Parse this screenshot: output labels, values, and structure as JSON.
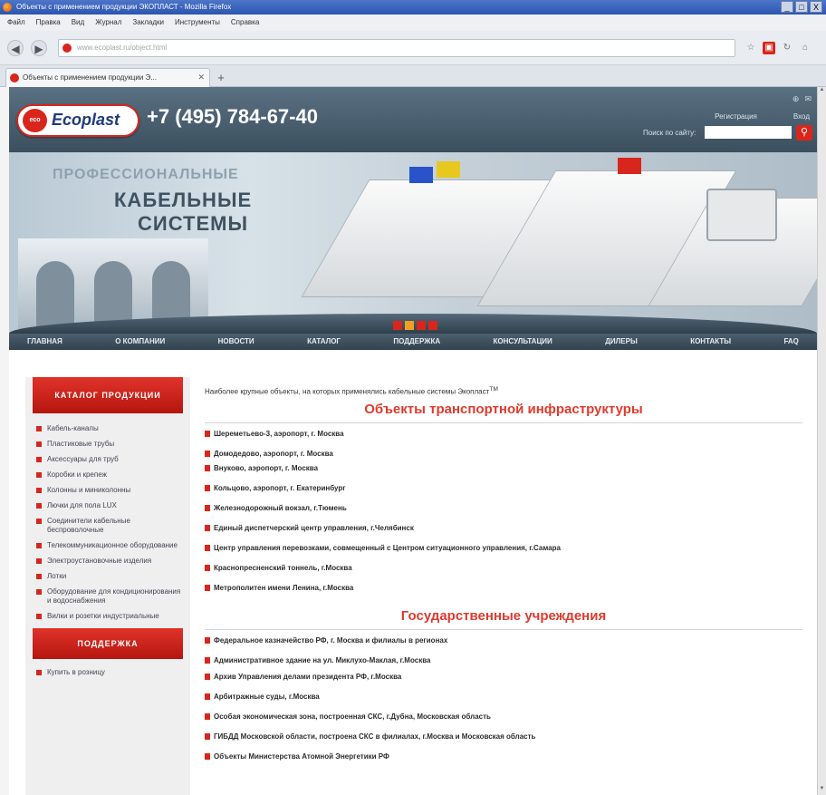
{
  "browser": {
    "window_title": "Объекты с применением продукции ЭКОПЛАСТ - Mozilla Firefox",
    "menu": [
      "Файл",
      "Правка",
      "Вид",
      "Журнал",
      "Закладки",
      "Инструменты",
      "Справка"
    ],
    "url": "www.ecoplast.ru/object.html",
    "tab_title": "Объекты с применением продукции Э...",
    "window_buttons": [
      "_",
      "□",
      "X"
    ]
  },
  "header": {
    "logo_badge": "eco",
    "logo_name": "Ecoplast",
    "phone": "+7 (495) 784-67-40",
    "links": [
      "Регистрация",
      "Вход"
    ],
    "search_label": "Поиск по сайту:"
  },
  "banner": {
    "line1": "ПРОФЕССИОНАЛЬНЫЕ",
    "line2": "КАБЕЛЬНЫЕ",
    "line3": "СИСТЕМЫ",
    "slide_count": 4,
    "active_slide": 2
  },
  "nav": [
    "ГЛАВНАЯ",
    "О КОМПАНИИ",
    "НОВОСТИ",
    "КАТАЛОГ",
    "ПОДДЕРЖКА",
    "КОНСУЛЬТАЦИИ",
    "ДИЛЕРЫ",
    "КОНТАКТЫ",
    "FAQ"
  ],
  "sidebar": {
    "catalog_title": "КАТАЛОГ ПРОДУКЦИИ",
    "catalog_items": [
      "Кабель-каналы",
      "Пластиковые трубы",
      "Аксессуары для труб",
      "Коробки и крепеж",
      "Колонны и миниколонны",
      "Лючки для пола LUX",
      "Соединители кабельные беспроволочные",
      "Телекоммуникационное оборудование",
      "Электроустановочные изделия",
      "Лотки",
      "Оборудование для кондиционирования и водоснабжения",
      "Вилки и розетки индустриальные"
    ],
    "support_title": "ПОДДЕРЖКА",
    "support_items": [
      "Купить в розницу"
    ]
  },
  "content": {
    "intro": "Наиболее крупные объекты, на которых применялись кабельные системы Экопласт",
    "intro_tm": "TM",
    "section1_title": "Объекты транспортной инфраструктуры",
    "section1_items": [
      "Шереметьево-3, аэропорт, г. Москва",
      "Домодедово, аэропорт, г. Москва",
      "Внуково, аэропорт, г. Москва",
      "Кольцово, аэропорт, г. Екатеринбург",
      "Железнодорожный вокзал, г.Тюмень",
      "Единый диспетчерский центр управления, г.Челябинск",
      "Центр управления перевозками, совмещенный с Центром ситуационного управления, г.Самара",
      "Краснопресненский тоннель, г.Москва",
      "Метрополитен имени Ленина, г.Москва"
    ],
    "section2_title": "Государственные учреждения",
    "section2_items": [
      "Федеральное казначейство РФ, г. Москва и филиалы в регионах",
      "Административное здание на ул. Миклухо-Маклая, г.Москва",
      "Архив Управления делами президента РФ, г.Москва",
      "Арбитражные суды, г.Москва",
      "Особая экономическая зона, построенная СКС, г.Дубна, Московская область",
      "ГИБДД Московской области, построена СКС в филиалах, г.Москва и Московская область",
      "Объекты Министерства Атомной Энергетики РФ"
    ]
  }
}
